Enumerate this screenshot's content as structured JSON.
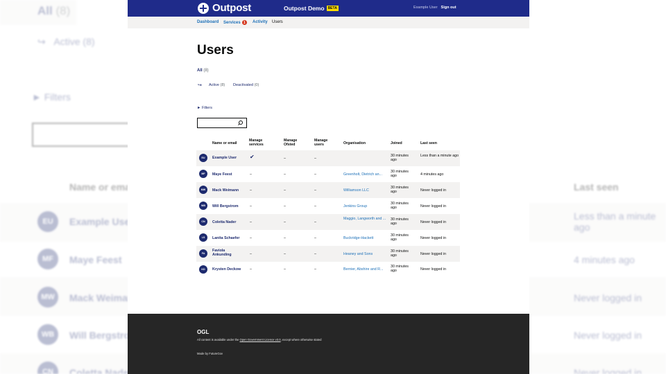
{
  "header": {
    "logo_text": "Outpost",
    "service_name": "Outpost Demo",
    "beta_badge": "BETA",
    "user_name": "Example User",
    "sign_out": "Sign out"
  },
  "nav": {
    "dashboard": "Dashboard",
    "services": "Services",
    "services_badge": "1",
    "activity": "Activity",
    "users": "Users"
  },
  "page": {
    "title": "Users",
    "tab_all": "All",
    "tab_all_count": "(8)",
    "tab_active": "Active",
    "tab_active_count": "(8)",
    "tab_deactivated": "Deactivated",
    "tab_deactivated_count": "(0)",
    "filters_label": "► Filters",
    "search_value": ""
  },
  "table": {
    "headers": {
      "name": "Name or email",
      "manage_services": "Manage services",
      "manage_ofsted": "Manage Ofsted",
      "manage_users": "Manage users",
      "organisation": "Organisation",
      "joined": "Joined",
      "last_seen": "Last seen"
    },
    "rows": [
      {
        "initials": "EU",
        "name": "Example User",
        "services": "✔",
        "ofsted": "–",
        "users": "–",
        "org": "",
        "joined": "30 minutes ago",
        "last_seen": "Less than a minute ago"
      },
      {
        "initials": "MF",
        "name": "Maye Feest",
        "services": "–",
        "ofsted": "–",
        "users": "–",
        "org": "Greenholt, Dietrich an...",
        "joined": "30 minutes ago",
        "last_seen": "4 minutes ago"
      },
      {
        "initials": "MW",
        "name": "Mack Weimann",
        "services": "–",
        "ofsted": "–",
        "users": "–",
        "org": "Williamson LLC",
        "joined": "30 minutes ago",
        "last_seen": "Never logged in"
      },
      {
        "initials": "WB",
        "name": "Will Bergstrom",
        "services": "–",
        "ofsted": "–",
        "users": "–",
        "org": "Jenkins Group",
        "joined": "30 minutes ago",
        "last_seen": "Never logged in"
      },
      {
        "initials": "CN",
        "name": "Coletta Nader",
        "services": "–",
        "ofsted": "–",
        "users": "–",
        "org": "Maggio, Langworth and ...",
        "joined": "30 minutes ago",
        "last_seen": "Never logged in"
      },
      {
        "initials": "LS",
        "name": "Lanita Schaefer",
        "services": "–",
        "ofsted": "–",
        "users": "–",
        "org": "Buckridge-Hackett",
        "joined": "30 minutes ago",
        "last_seen": "Never logged in"
      },
      {
        "initials": "FA",
        "name": "Faviola Ankunding",
        "services": "–",
        "ofsted": "–",
        "users": "–",
        "org": "Heaney and Sons",
        "joined": "30 minutes ago",
        "last_seen": "Never logged in"
      },
      {
        "initials": "KD",
        "name": "Krysten Deckow",
        "services": "–",
        "ofsted": "–",
        "users": "–",
        "org": "Bernier, Abshire and R...",
        "joined": "30 minutes ago",
        "last_seen": "Never logged in"
      }
    ]
  },
  "footer": {
    "ogl": "OGL",
    "licence_prefix": "All content is available under the ",
    "licence_link": "Open Government Licence v3.0",
    "licence_suffix": ", except where otherwise stated",
    "made_by": "Made by FutureGov"
  },
  "colors": {
    "header_bg": "#1f2b8a",
    "link": "#1d70b8",
    "avatar_bg": "#1d2a6e",
    "badge": "#d4351c",
    "beta": "#ffdd00",
    "footer_bg": "#262626"
  }
}
